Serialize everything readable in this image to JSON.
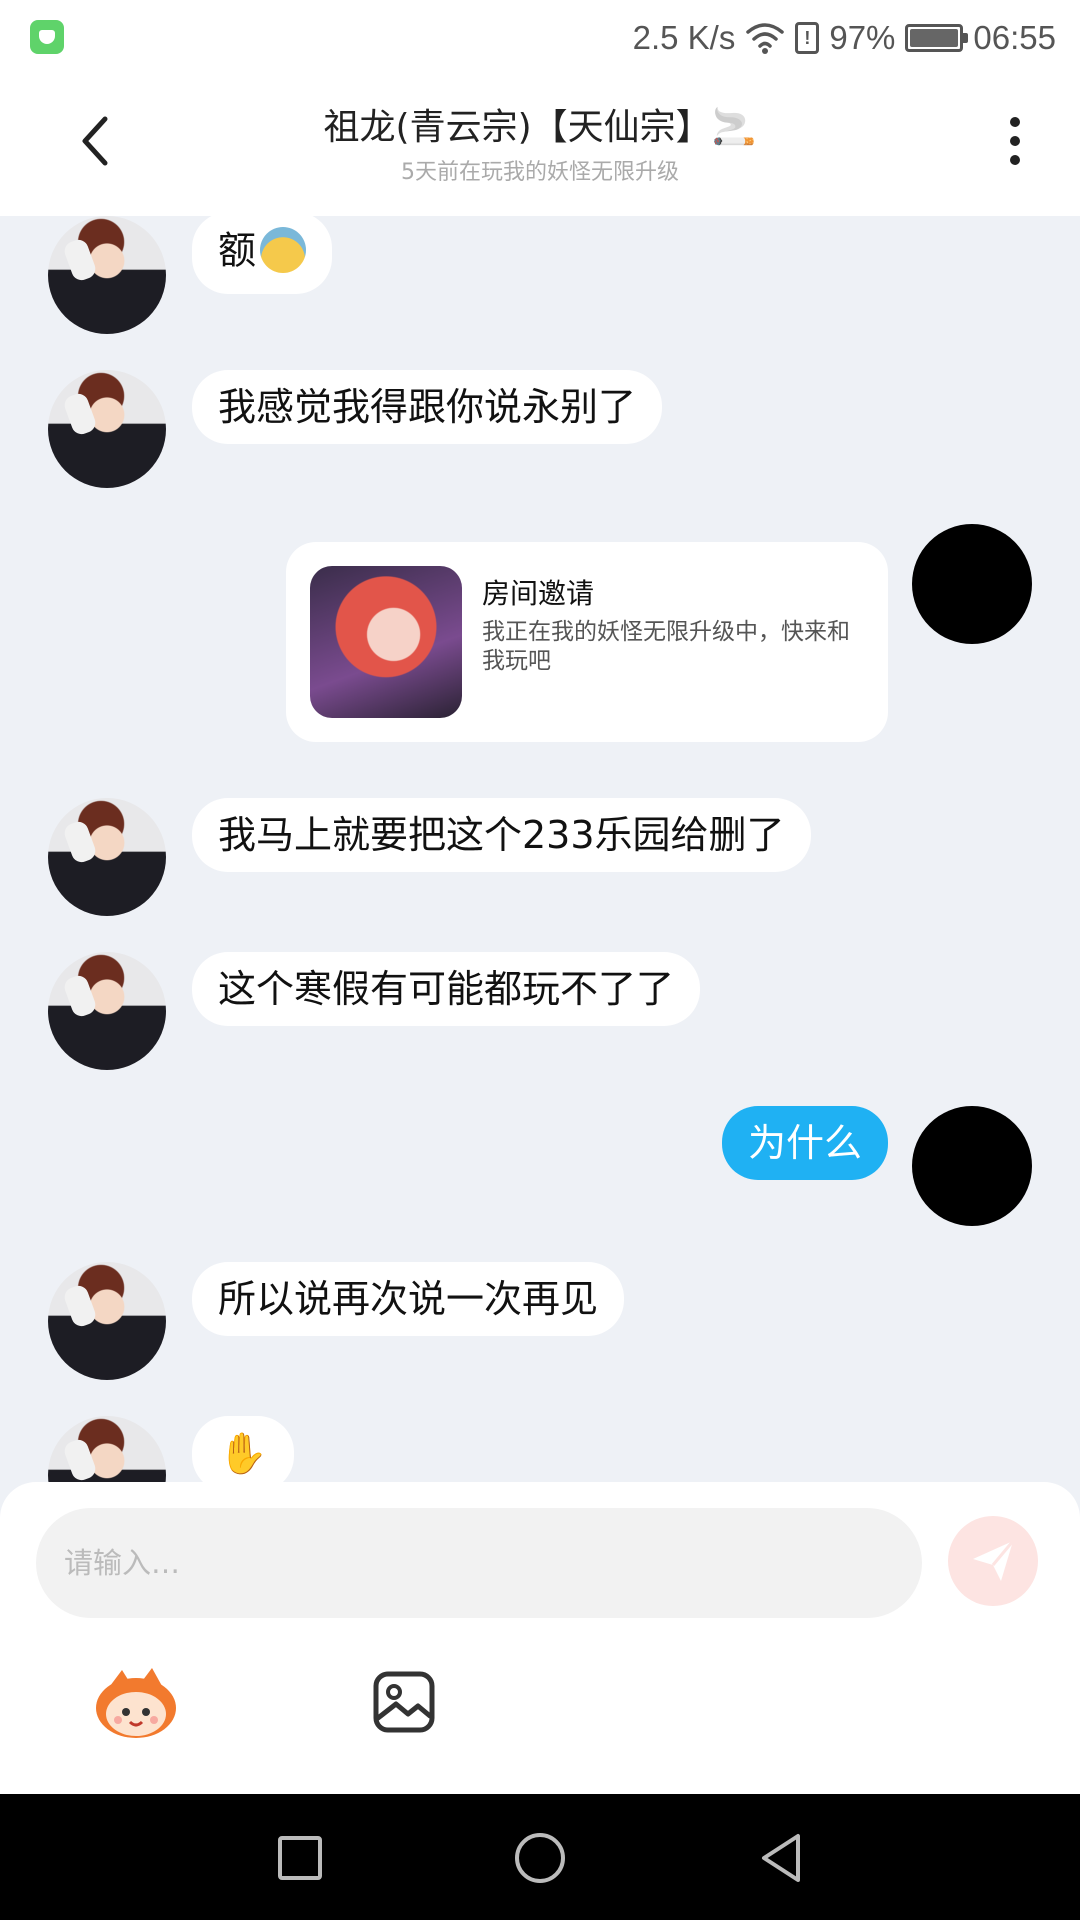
{
  "status_bar": {
    "speed": "2.5 K/s",
    "battery": "97%",
    "time": "06:55",
    "icons": [
      "app-icon",
      "wifi-icon",
      "alert-icon",
      "battery-icon"
    ]
  },
  "header": {
    "title": "祖龙(青云宗)【天仙宗】🚬",
    "subtitle": "5天前在玩我的妖怪无限升级",
    "back_icon": "chevron-left-icon",
    "more_icon": "more-vertical-icon"
  },
  "messages": [
    {
      "sender": "friend",
      "text": "额",
      "emoji": "sweat-emoji"
    },
    {
      "sender": "friend",
      "text": "我感觉我得跟你说永别了"
    },
    {
      "sender": "self",
      "type": "invite",
      "title": "房间邀请",
      "desc": "我正在我的妖怪无限升级中，快来和我玩吧"
    },
    {
      "sender": "friend",
      "text": "我马上就要把这个233乐园给删了"
    },
    {
      "sender": "friend",
      "text": "这个寒假有可能都玩不了了"
    },
    {
      "sender": "self",
      "text": "为什么"
    },
    {
      "sender": "friend",
      "text": "所以说再次说一次再见"
    },
    {
      "sender": "friend",
      "text": "✋"
    }
  ],
  "composer": {
    "placeholder": "请输入…",
    "value": "",
    "send_icon": "send-icon",
    "tools": [
      "mascot-icon",
      "image-icon"
    ]
  },
  "colors": {
    "background": "#eef1f6",
    "self_bubble": "#1fb1f3",
    "friend_bubble": "#ffffff",
    "send_button": "#fde4e2"
  },
  "nav": [
    "square-icon",
    "circle-icon",
    "triangle-back-icon"
  ]
}
